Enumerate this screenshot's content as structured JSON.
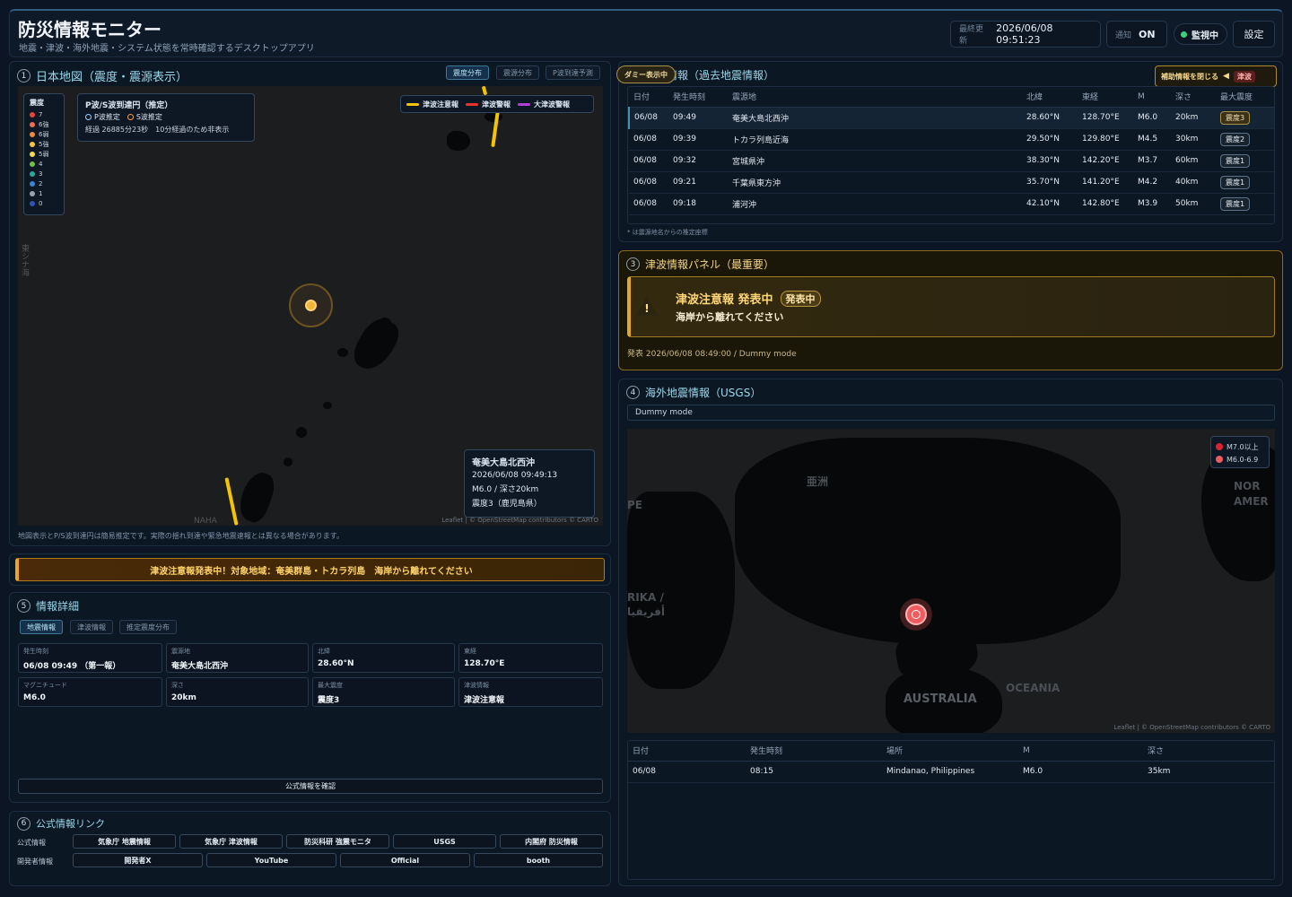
{
  "header": {
    "title": "防災情報モニター",
    "subtitle": "地震・津波・海外地震・システム状態を常時確認するデスクトップアプリ",
    "last_update_label": "最終更新",
    "last_update_value": "2026/06/08 09:51:23",
    "notify_label": "通知",
    "notify_value": "ON",
    "monitor_label": "監視中",
    "settings_label": "設定"
  },
  "map_panel": {
    "number": "1",
    "title": "日本地図（震度・震源表示）",
    "tabs": [
      "震度分布",
      "震源分布",
      "P波到達予測"
    ],
    "intensity_legend_title": "震度",
    "intensity_legend": [
      {
        "label": "7",
        "color": "#e8433b"
      },
      {
        "label": "6強",
        "color": "#ef6f4a"
      },
      {
        "label": "6弱",
        "color": "#f08a3c"
      },
      {
        "label": "5強",
        "color": "#f6c443"
      },
      {
        "label": "5弱",
        "color": "#f4db55"
      },
      {
        "label": "4",
        "color": "#6cc24a"
      },
      {
        "label": "3",
        "color": "#2fa89c"
      },
      {
        "label": "2",
        "color": "#3d84d6"
      },
      {
        "label": "1",
        "color": "#9aa3ad"
      },
      {
        "label": "0",
        "color": "#2f52b8"
      }
    ],
    "ps_title": "P波/S波到達円（推定）",
    "ps_p_label": "P波推定",
    "ps_s_label": "S波推定",
    "ps_elapsed": "経過 26885分23秒　10分経過のため非表示",
    "tsunami_legend": [
      {
        "label": "津波注意報",
        "color": "#f5c400"
      },
      {
        "label": "津波警報",
        "color": "#e8322e"
      },
      {
        "label": "大津波警報",
        "color": "#b23fd0"
      }
    ],
    "popup_place": "奄美大島北西沖",
    "popup_time": "2026/06/08 09:49:13",
    "popup_mag": "M6.0 / 深さ20km",
    "popup_intensity": "震度3（鹿児島県）",
    "side_label": "東シナ海",
    "naha_label": "NAHA",
    "attribution": "Leaflet | © OpenStreetMap contributors © CARTO",
    "footnote": "地図表示とP/S波到達円は簡易推定です。実際の揺れ到達や緊急地震速報とは異なる場合があります。"
  },
  "alert_banner": "津波注意報発表中！対象地域：奄美群島・トカラ列島　海岸から離れてください",
  "quake_panel": {
    "number": "2",
    "dummy_badge": "ダミー表示中",
    "title": "地震情報（過去地震情報）",
    "toggle_label": "補助情報を閉じる",
    "tsunami_tag": "津波",
    "columns": [
      "日付",
      "発生時刻",
      "震源地",
      "北緯",
      "東経",
      "M",
      "深さ",
      "最大震度"
    ],
    "rows": [
      {
        "date": "06/08",
        "time": "09:49",
        "place": "奄美大島北西沖",
        "lat": "28.60°N",
        "lon": "128.70°E",
        "mag": "M6.0",
        "depth": "20km",
        "intensity": "震度3"
      },
      {
        "date": "06/08",
        "time": "09:39",
        "place": "トカラ列島近海",
        "lat": "29.50°N",
        "lon": "129.80°E",
        "mag": "M4.5",
        "depth": "30km",
        "intensity": "震度2"
      },
      {
        "date": "06/08",
        "time": "09:32",
        "place": "宮城県沖",
        "lat": "38.30°N",
        "lon": "142.20°E",
        "mag": "M3.7",
        "depth": "60km",
        "intensity": "震度1"
      },
      {
        "date": "06/08",
        "time": "09:21",
        "place": "千葉県東方沖",
        "lat": "35.70°N",
        "lon": "141.20°E",
        "mag": "M4.2",
        "depth": "40km",
        "intensity": "震度1"
      },
      {
        "date": "06/08",
        "time": "09:18",
        "place": "浦河沖",
        "lat": "42.10°N",
        "lon": "142.80°E",
        "mag": "M3.9",
        "depth": "50km",
        "intensity": "震度1"
      }
    ],
    "note": "* は震源地名からの推定座標"
  },
  "tsunami_panel": {
    "number": "3",
    "title": "津波情報パネル（最重要）",
    "headline": "津波注意報 発表中",
    "status_badge": "発表中",
    "message": "海岸から離れてください",
    "issued": "発表 2026/06/08 08:49:00 / Dummy mode"
  },
  "usgs_panel": {
    "number": "4",
    "title": "海外地震情報（USGS）",
    "mode": "Dummy mode",
    "legend": [
      {
        "label": "M7.0以上",
        "color": "#d9232e"
      },
      {
        "label": "M6.0-6.9",
        "color": "#ef5b5f"
      }
    ],
    "map_labels": [
      "亜洲",
      "NOR AMER",
      "PE",
      "RIKA / أفريقيا",
      "AUSTRALIA",
      "OCEANIA"
    ],
    "attribution": "Leaflet | © OpenStreetMap contributors © CARTO",
    "columns": [
      "日付",
      "発生時刻",
      "場所",
      "M",
      "深さ"
    ],
    "rows": [
      {
        "date": "06/08",
        "time": "08:15",
        "place": "Mindanao, Philippines",
        "mag": "M6.0",
        "depth": "35km"
      }
    ]
  },
  "detail_panel": {
    "number": "5",
    "title": "情報詳細",
    "tabs": [
      "地震情報",
      "津波情報",
      "推定震度分布"
    ],
    "fields": [
      {
        "label": "発生時刻",
        "value": "06/08 09:49 （第一報）"
      },
      {
        "label": "震源地",
        "value": "奄美大島北西沖"
      },
      {
        "label": "北緯",
        "value": "28.60°N"
      },
      {
        "label": "東経",
        "value": "128.70°E"
      },
      {
        "label": "マグニチュード",
        "value": "M6.0"
      },
      {
        "label": "深さ",
        "value": "20km"
      },
      {
        "label": "最大震度",
        "value": "震度3"
      },
      {
        "label": "津波情報",
        "value": "津波注意報"
      }
    ],
    "official_button": "公式情報を確認"
  },
  "links_panel": {
    "number": "6",
    "title": "公式情報リンク",
    "official_label": "公式情報",
    "official_links": [
      "気象庁 地震情報",
      "気象庁 津波情報",
      "防災科研 強震モニタ",
      "USGS",
      "内閣府 防災情報"
    ],
    "dev_label": "開発者情報",
    "dev_links": [
      "開発者X",
      "YouTube",
      "Official",
      "booth"
    ]
  }
}
